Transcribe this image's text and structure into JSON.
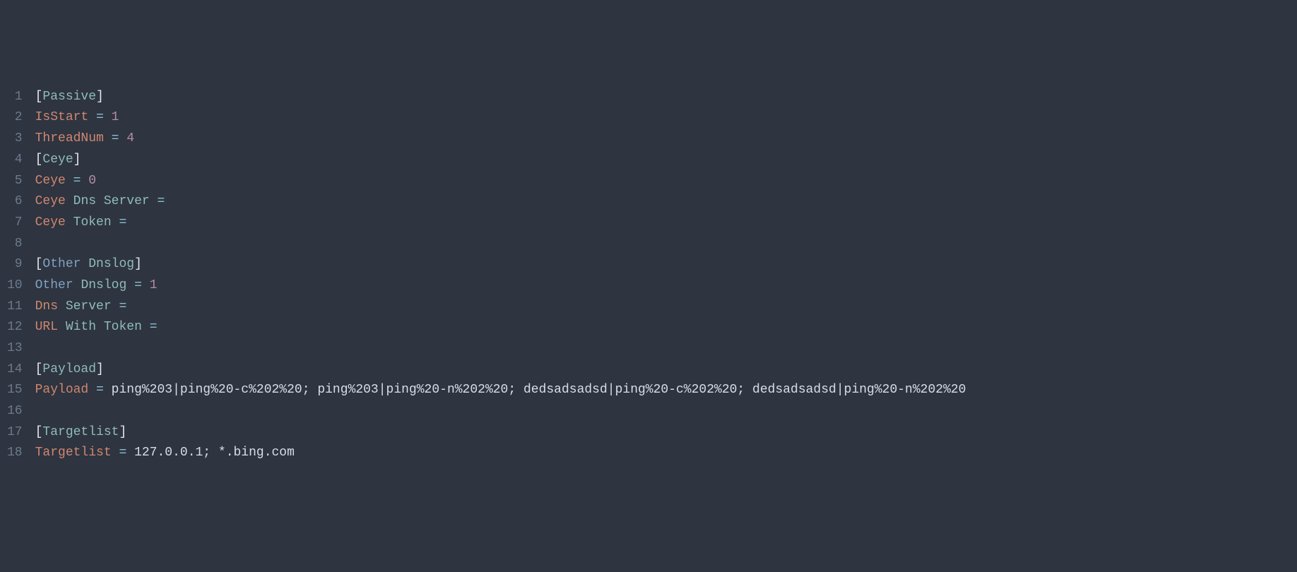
{
  "lineNumbers": [
    "1",
    "2",
    "3",
    "4",
    "5",
    "6",
    "7",
    "8",
    "9",
    "10",
    "11",
    "12",
    "13",
    "14",
    "15",
    "16",
    "17",
    "18"
  ],
  "lines": [
    {
      "tokens": [
        {
          "t": "[",
          "c": "section"
        },
        {
          "t": "Passive",
          "c": "ident"
        },
        {
          "t": "]",
          "c": "section"
        }
      ]
    },
    {
      "tokens": [
        {
          "t": "IsStart",
          "c": "key"
        },
        {
          "t": " ",
          "c": "text"
        },
        {
          "t": "=",
          "c": "eq"
        },
        {
          "t": " ",
          "c": "text"
        },
        {
          "t": "1",
          "c": "num"
        }
      ]
    },
    {
      "tokens": [
        {
          "t": "ThreadNum",
          "c": "key"
        },
        {
          "t": " ",
          "c": "text"
        },
        {
          "t": "=",
          "c": "eq"
        },
        {
          "t": " ",
          "c": "text"
        },
        {
          "t": "4",
          "c": "num"
        }
      ]
    },
    {
      "tokens": [
        {
          "t": "[",
          "c": "section"
        },
        {
          "t": "Ceye",
          "c": "ident"
        },
        {
          "t": "]",
          "c": "section"
        }
      ]
    },
    {
      "tokens": [
        {
          "t": "Ceye",
          "c": "key"
        },
        {
          "t": " ",
          "c": "text"
        },
        {
          "t": "=",
          "c": "eq"
        },
        {
          "t": " ",
          "c": "text"
        },
        {
          "t": "0",
          "c": "num"
        }
      ]
    },
    {
      "tokens": [
        {
          "t": "Ceye",
          "c": "key"
        },
        {
          "t": " ",
          "c": "text"
        },
        {
          "t": "Dns",
          "c": "ident"
        },
        {
          "t": " ",
          "c": "text"
        },
        {
          "t": "Server",
          "c": "ident"
        },
        {
          "t": " ",
          "c": "text"
        },
        {
          "t": "=",
          "c": "eq"
        }
      ]
    },
    {
      "tokens": [
        {
          "t": "Ceye",
          "c": "key"
        },
        {
          "t": " ",
          "c": "text"
        },
        {
          "t": "Token",
          "c": "ident"
        },
        {
          "t": " ",
          "c": "text"
        },
        {
          "t": "=",
          "c": "eq"
        }
      ]
    },
    {
      "tokens": []
    },
    {
      "tokens": [
        {
          "t": "[",
          "c": "section"
        },
        {
          "t": "Other",
          "c": "keyword"
        },
        {
          "t": " ",
          "c": "text"
        },
        {
          "t": "Dnslog",
          "c": "ident"
        },
        {
          "t": "]",
          "c": "section"
        }
      ]
    },
    {
      "tokens": [
        {
          "t": "Other",
          "c": "keyword"
        },
        {
          "t": " ",
          "c": "text"
        },
        {
          "t": "Dnslog",
          "c": "ident"
        },
        {
          "t": " ",
          "c": "text"
        },
        {
          "t": "=",
          "c": "eq"
        },
        {
          "t": " ",
          "c": "text"
        },
        {
          "t": "1",
          "c": "num"
        }
      ]
    },
    {
      "tokens": [
        {
          "t": "Dns",
          "c": "key"
        },
        {
          "t": " ",
          "c": "text"
        },
        {
          "t": "Server",
          "c": "ident"
        },
        {
          "t": " ",
          "c": "text"
        },
        {
          "t": "=",
          "c": "eq"
        }
      ]
    },
    {
      "tokens": [
        {
          "t": "URL",
          "c": "key"
        },
        {
          "t": " ",
          "c": "text"
        },
        {
          "t": "With",
          "c": "ident"
        },
        {
          "t": " ",
          "c": "text"
        },
        {
          "t": "Token",
          "c": "ident"
        },
        {
          "t": " ",
          "c": "text"
        },
        {
          "t": "=",
          "c": "eq"
        }
      ]
    },
    {
      "tokens": []
    },
    {
      "tokens": [
        {
          "t": "[",
          "c": "section"
        },
        {
          "t": "Payload",
          "c": "ident"
        },
        {
          "t": "]",
          "c": "section"
        }
      ]
    },
    {
      "tokens": [
        {
          "t": "Payload",
          "c": "key"
        },
        {
          "t": " ",
          "c": "text"
        },
        {
          "t": "=",
          "c": "eq"
        },
        {
          "t": " ",
          "c": "text"
        },
        {
          "t": "ping%203|ping%20-c%202%20; ping%203|ping%20-n%202%20; dedsadsadsd|ping%20-c%202%20; dedsadsadsd|ping%20-n%202%20",
          "c": "text"
        }
      ]
    },
    {
      "tokens": []
    },
    {
      "tokens": [
        {
          "t": "[",
          "c": "section"
        },
        {
          "t": "Targetlist",
          "c": "ident"
        },
        {
          "t": "]",
          "c": "section"
        }
      ]
    },
    {
      "tokens": [
        {
          "t": "Targetlist",
          "c": "key"
        },
        {
          "t": " ",
          "c": "text"
        },
        {
          "t": "=",
          "c": "eq"
        },
        {
          "t": " ",
          "c": "text"
        },
        {
          "t": "127.0.0.1; *.bing.com",
          "c": "text"
        }
      ]
    }
  ]
}
